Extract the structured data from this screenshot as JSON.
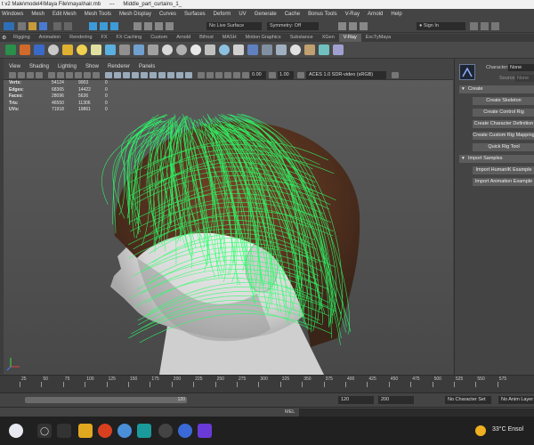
{
  "window": {
    "title_parts": [
      "t v2 Male\\model4\\Maya File\\maya\\hair.mb",
      "---",
      "Middle_part_curtains_1_"
    ]
  },
  "menubar": {
    "items": [
      "Windows",
      "Mesh",
      "Edit Mesh",
      "Mesh Tools",
      "Mesh Display",
      "Curves",
      "Surfaces",
      "Deform",
      "UV",
      "Generate",
      "Cache",
      "Bonus Tools",
      "V-Ray",
      "Arnold",
      "Help"
    ]
  },
  "statusline": {
    "live_surface": "No Live Surface",
    "symmetry": "Symmetry: Off",
    "sign_in": "Sign In"
  },
  "shelf": {
    "tabs": [
      "Rigging",
      "Animation",
      "Rendering",
      "FX",
      "FX Caching",
      "Custom",
      "Arnold",
      "Bifrost",
      "MASH",
      "Motion Graphics",
      "Substance",
      "XGen",
      "V-Ray",
      "ExcTyMaya"
    ],
    "active_tab": "V-Ray"
  },
  "panel": {
    "menu": [
      "View",
      "Shading",
      "Lighting",
      "Show",
      "Renderer",
      "Panels"
    ],
    "exposure": "0.00",
    "gamma": "1.00",
    "color_space": "ACES 1.0 SDR-video (sRGB)"
  },
  "hud": {
    "rows": [
      {
        "label": "Verts:",
        "total": "54124",
        "selected": "9003",
        "extra": "0"
      },
      {
        "label": "Edges:",
        "total": "68365",
        "selected": "14422",
        "extra": "0"
      },
      {
        "label": "Faces:",
        "total": "28096",
        "selected": "5636",
        "extra": "0"
      },
      {
        "label": "Tris:",
        "total": "46550",
        "selected": "11306",
        "extra": "0"
      },
      {
        "label": "UVs:",
        "total": "71918",
        "selected": "19861",
        "extra": "0"
      }
    ]
  },
  "hik": {
    "character_label": "Character:",
    "character_value": "None",
    "source_label": "Source:",
    "source_value": "None",
    "section_create": "Create",
    "create_buttons": [
      "Create Skeleton",
      "Create Control Rig",
      "Create Character Definition",
      "Create Custom Rig Mapping",
      "Quick Rig Tool"
    ],
    "section_import": "Import Samples",
    "import_buttons": [
      "Import HumanIK Example",
      "Import Animation Example"
    ]
  },
  "timeline": {
    "ticks": [
      "25",
      "50",
      "75",
      "100",
      "125",
      "150",
      "175",
      "200",
      "225",
      "250",
      "275",
      "300",
      "325",
      "350",
      "375",
      "400",
      "425",
      "450",
      "475",
      "500",
      "525",
      "550",
      "575"
    ],
    "range_slider_end": "120",
    "end_time": "120",
    "anim_end": "200",
    "no_character_set": "No Character Set",
    "no_anim_layer": "No Anim Layer"
  },
  "mel": {
    "label": "MEL"
  },
  "taskbar": {
    "temperature": "33°C",
    "weather": "Ensol"
  },
  "colors": {
    "hair_wire": "#2bff6a",
    "hair_base": "#6a3a22",
    "skin": "#e4e4e4",
    "accent_active": "#5d5d5d"
  }
}
